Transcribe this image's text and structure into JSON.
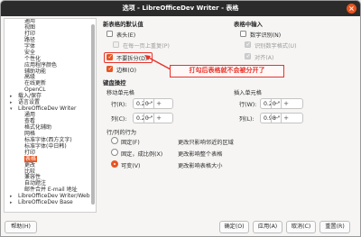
{
  "window": {
    "title": "选项 - LibreOfficeDev Writer - 表格"
  },
  "tree": {
    "items": [
      {
        "label": "通用",
        "level": 2
      },
      {
        "label": "视图",
        "level": 2
      },
      {
        "label": "打印",
        "level": 2
      },
      {
        "label": "路径",
        "level": 2
      },
      {
        "label": "字体",
        "level": 2
      },
      {
        "label": "安全",
        "level": 2
      },
      {
        "label": "个性化",
        "level": 2
      },
      {
        "label": "应用程序颜色",
        "level": 2
      },
      {
        "label": "辅助功能",
        "level": 2
      },
      {
        "label": "高级",
        "level": 2
      },
      {
        "label": "在线更新",
        "level": 2
      },
      {
        "label": "OpenCL",
        "level": 2
      },
      {
        "label": "载入/保存",
        "level": 1,
        "arrow": "▸"
      },
      {
        "label": "语言设置",
        "level": 1,
        "arrow": "▸"
      },
      {
        "label": "LibreOfficeDev Writer",
        "level": 1,
        "arrow": "▾"
      },
      {
        "label": "通用",
        "level": 2
      },
      {
        "label": "查看",
        "level": 2
      },
      {
        "label": "格式化辅助",
        "level": 2
      },
      {
        "label": "网格",
        "level": 2
      },
      {
        "label": "标准字体(西方文字)",
        "level": 2
      },
      {
        "label": "标准字体(中日韩)",
        "level": 2
      },
      {
        "label": "打印",
        "level": 2
      },
      {
        "label": "表格",
        "level": 2,
        "selected": true
      },
      {
        "label": "更改",
        "level": 2
      },
      {
        "label": "比较",
        "level": 2
      },
      {
        "label": "兼容性",
        "level": 2
      },
      {
        "label": "自动题注",
        "level": 2
      },
      {
        "label": "邮件合并 E-mail 地址",
        "level": 2
      },
      {
        "label": "LibreOfficeDev Writer/Web",
        "level": 1,
        "arrow": "▸"
      },
      {
        "label": "LibreOfficeDev Base",
        "level": 1,
        "arrow": "▸"
      }
    ]
  },
  "defaults": {
    "heading": "新表格的默认值",
    "header": "表头(E)",
    "repeat": "在每一页上重复(P)",
    "no_split": "不要拆分(D)",
    "border": "边框(O)"
  },
  "input": {
    "heading": "表格中输入",
    "number_recognition": "数字识别(N)",
    "number_format": "识别数字格式(U)",
    "alignment": "对齐(A)"
  },
  "keyboard": {
    "heading": "键盘操控",
    "move_cells": "移动单元格",
    "insert_cells": "插入单元格",
    "move_row_label": "行(R):",
    "move_row_value": "0.20 \"",
    "move_col_label": "列(C):",
    "move_col_value": "0.20 \"",
    "insert_row_label": "行(W):",
    "insert_row_value": "0.20 \"",
    "insert_col_label": "列(L):",
    "insert_col_value": "0.98 \""
  },
  "behavior": {
    "heading": "行/列的行为",
    "fixed": "固定(F)",
    "fixed_desc": "更改只影响邻近的区域",
    "fixed_prop": "固定，成比例(X)",
    "fixed_prop_desc": "更改影响整个表格",
    "variable": "可变(V)",
    "variable_desc": "更改影响表格大小"
  },
  "annotation": "打勾后表格就不会被分开了",
  "buttons": {
    "help": "帮助(H)",
    "reset": "重置(R)",
    "apply": "应用(A)",
    "cancel": "取消(C)",
    "ok": "确定(O)"
  },
  "colors": {
    "accent": "#e95420",
    "callout": "#e8322a"
  }
}
